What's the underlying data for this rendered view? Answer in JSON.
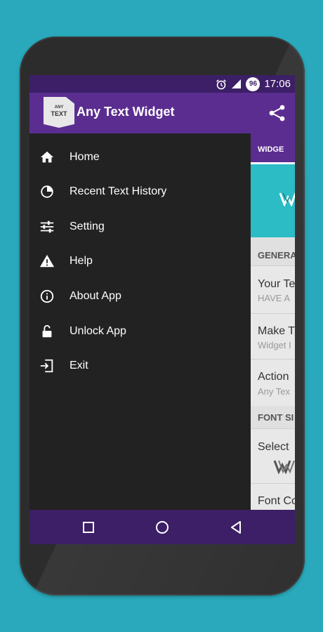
{
  "status": {
    "time": "17:06",
    "battery": "96"
  },
  "app": {
    "title": "Any Text Widget",
    "logo_line1": "ANY",
    "logo_line2": "TEXT"
  },
  "drawer": {
    "items": [
      {
        "label": "Home",
        "icon": "home-icon"
      },
      {
        "label": "Recent Text History",
        "icon": "history-icon"
      },
      {
        "label": "Setting",
        "icon": "sliders-icon"
      },
      {
        "label": "Help",
        "icon": "warning-icon"
      },
      {
        "label": "About App",
        "icon": "info-icon"
      },
      {
        "label": "Unlock App",
        "icon": "lock-icon"
      },
      {
        "label": "Exit",
        "icon": "exit-icon"
      }
    ]
  },
  "content": {
    "tab": "WIDGE",
    "general_header": "GENERA",
    "your_text_title": "Your Te",
    "your_text_sub": "HAVE A",
    "make_title": "Make T",
    "make_sub": "Widget I",
    "action_title": "Action",
    "action_sub": "Any Tex",
    "font_header": "FONT SI",
    "select_title": "Select",
    "font_color_title": "Font Co"
  },
  "colors": {
    "primary": "#5b2d91",
    "primary_dark": "#3c1f66",
    "drawer_bg": "#222222",
    "background": "#29a9bb",
    "preview": "#2bbcc6"
  }
}
